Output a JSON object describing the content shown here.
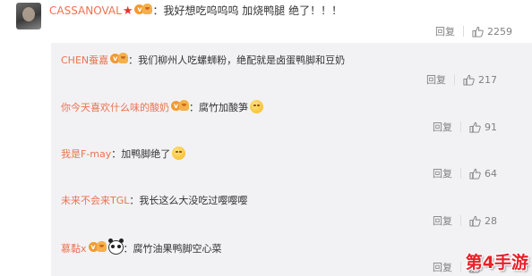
{
  "main_comment": {
    "username": "CASSANOVAL",
    "text": "我好想吃呜呜呜 加烧鸭腿 绝了！！！",
    "timestamp": "",
    "reply_label": "回复",
    "likes": "2259"
  },
  "replies": [
    {
      "username": "CHEN蚕嘉",
      "text": "我们柳州人吃螺蛳粉，绝配就是卤蛋鸭脚和豆奶",
      "reply_label": "回复",
      "likes": "217",
      "emoji": ""
    },
    {
      "username": "你今天喜欢什么味的酸奶",
      "text": "腐竹加酸笋",
      "reply_label": "回复",
      "likes": "91",
      "emoji": "smile-emoji"
    },
    {
      "username": "我是F-may",
      "text": "加鸭脚绝了",
      "reply_label": "回复",
      "likes": "64",
      "emoji": "grin-emoji"
    },
    {
      "username": "未来不会来TGL",
      "text": "我长这么大没吃过嘤嘤嘤",
      "reply_label": "回复",
      "likes": "28",
      "emoji": ""
    },
    {
      "username": "慕黏x",
      "text": "腐竹油果鸭脚空心菜",
      "reply_label": "回复",
      "likes": "",
      "emoji": "panda-emoji"
    }
  ],
  "watermark": "第4手游",
  "colors": {
    "username": "#eb7350",
    "text": "#333333",
    "meta": "#808080",
    "panel_bg": "#f2f2f5",
    "watermark": "#e6212a"
  }
}
